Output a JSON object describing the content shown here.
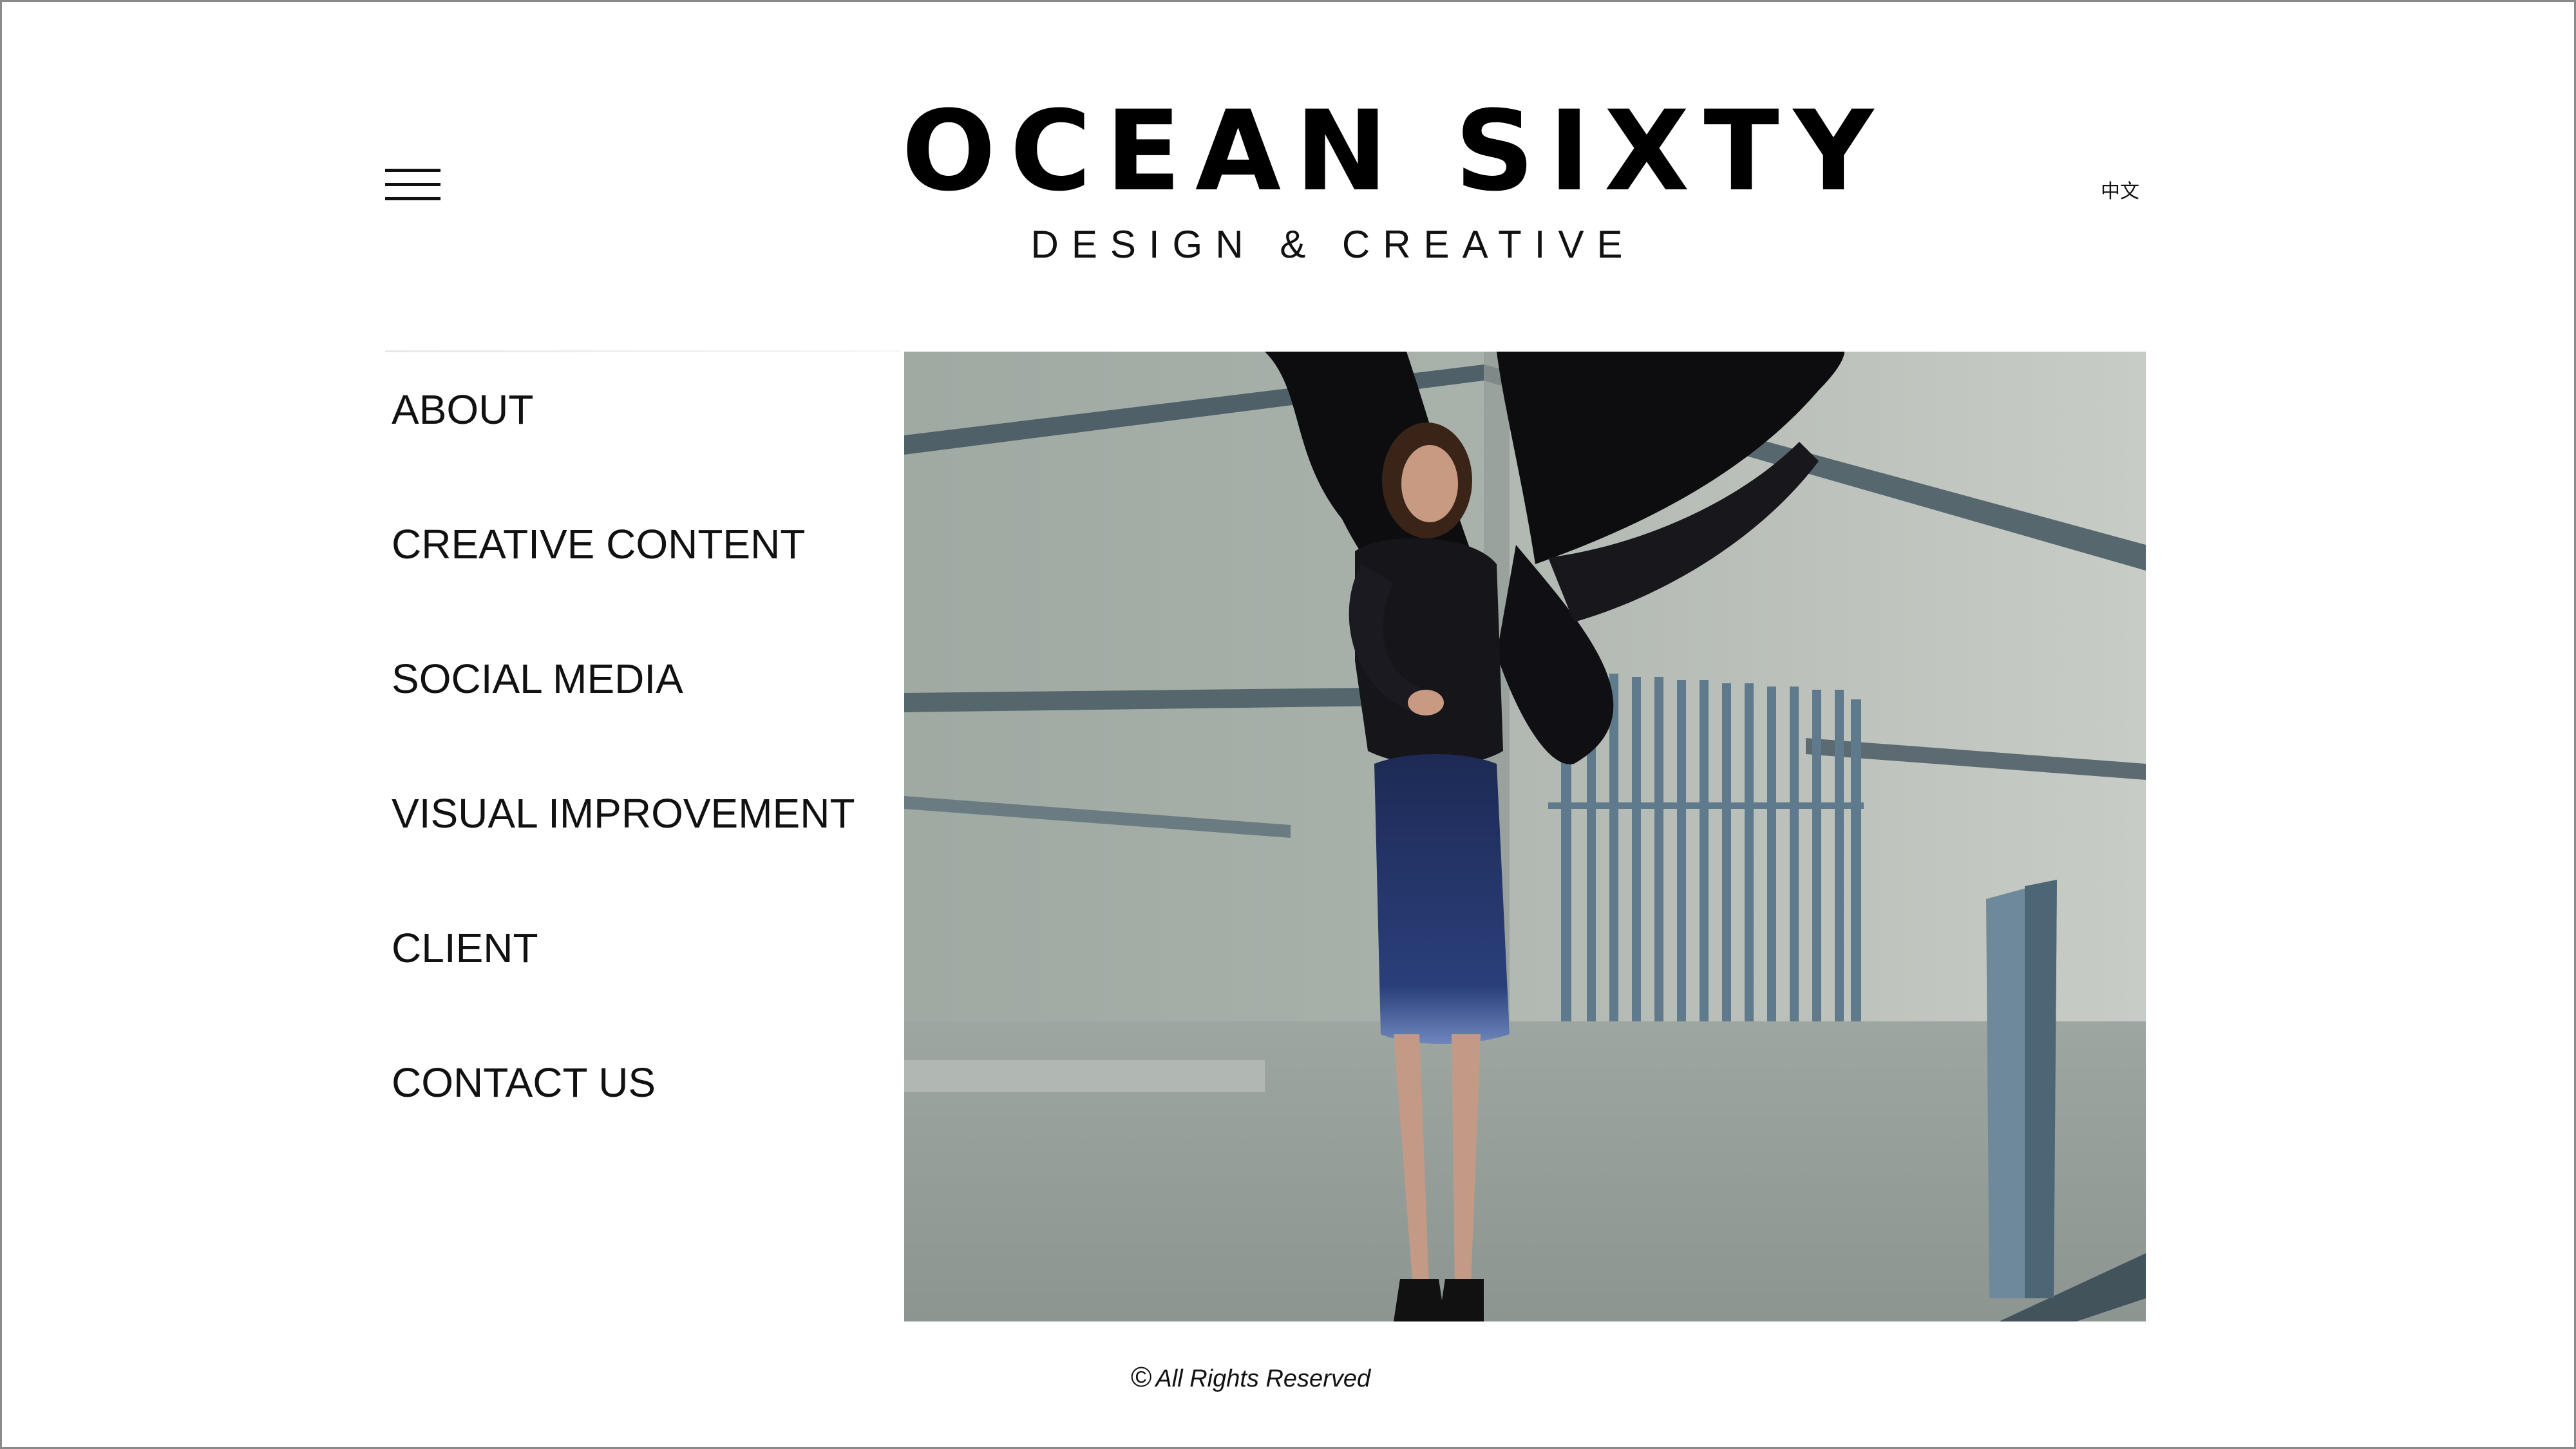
{
  "brand": {
    "name": "OCEAN SIXTY",
    "tagline": "DESIGN & CREATIVE"
  },
  "header": {
    "menu_icon": "hamburger-icon",
    "language_label": "中文"
  },
  "nav": {
    "items": [
      {
        "label": "ABOUT"
      },
      {
        "label": "CREATIVE CONTENT"
      },
      {
        "label": "SOCIAL MEDIA"
      },
      {
        "label": "VISUAL IMPROVEMENT"
      },
      {
        "label": "CLIENT"
      },
      {
        "label": "CONTACT US"
      }
    ]
  },
  "footer": {
    "copyright_symbol": "©",
    "text": "All Rights Reserved"
  },
  "colors": {
    "text": "#111111",
    "background": "#ffffff",
    "frame": "#8a8a8a"
  }
}
